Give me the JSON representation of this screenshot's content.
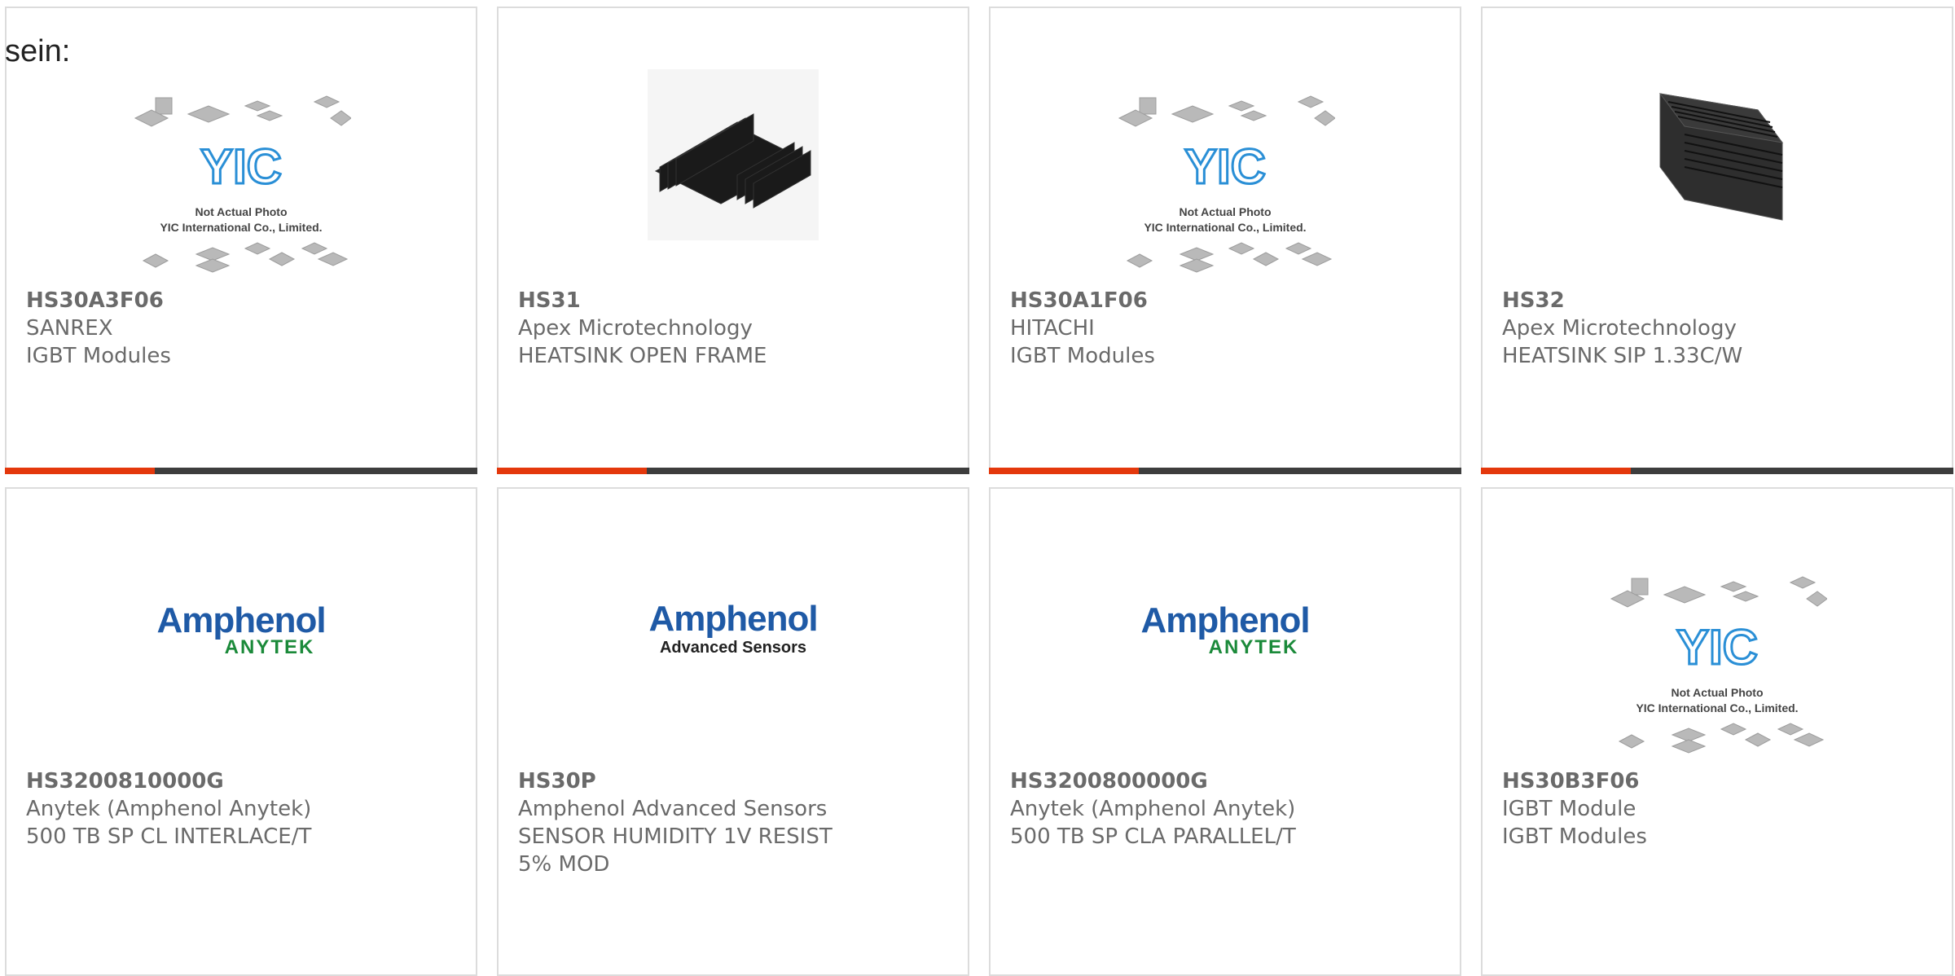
{
  "lead_text": "sein:",
  "placeholder_image": {
    "logo_text": "YIC",
    "caption_line1": "Not Actual Photo",
    "caption_line2": "YIC International Co., Limited."
  },
  "logos": {
    "amphenol": "Amphenol",
    "anytek": "ANYTEK",
    "advanced_sensors": "Advanced Sensors"
  },
  "colors": {
    "accent": "#e4380c",
    "bar": "#3d3d3d",
    "text": "#6a6a6a",
    "amphenol_blue": "#1f5aa6",
    "anytek_green": "#1b8a3a"
  },
  "products": [
    {
      "part": "HS30A3F06",
      "manufacturer": "SANREX",
      "description": "IGBT Modules",
      "image": "placeholder"
    },
    {
      "part": "HS31",
      "manufacturer": "Apex Microtechnology",
      "description": "HEATSINK OPEN FRAME",
      "image": "heatsink-open"
    },
    {
      "part": "HS30A1F06",
      "manufacturer": "HITACHI",
      "description": "IGBT Modules",
      "image": "placeholder"
    },
    {
      "part": "HS32",
      "manufacturer": "Apex Microtechnology",
      "description": "HEATSINK SIP 1.33C/W",
      "image": "heatsink-sip"
    },
    {
      "part": "HS3200810000G",
      "manufacturer": "Anytek (Amphenol Anytek)",
      "description": "500 TB SP CL INTERLACE/T",
      "image": "amphenol-anytek"
    },
    {
      "part": "HS30P",
      "manufacturer": "Amphenol Advanced Sensors",
      "description": "SENSOR HUMIDITY 1V RESIST\n5% MOD",
      "image": "amphenol-sensors"
    },
    {
      "part": "HS3200800000G",
      "manufacturer": "Anytek (Amphenol Anytek)",
      "description": "500 TB SP CLA PARALLEL/T",
      "image": "amphenol-anytek"
    },
    {
      "part": "HS30B3F06",
      "manufacturer": "IGBT Module",
      "description": "IGBT Modules",
      "image": "placeholder"
    }
  ]
}
